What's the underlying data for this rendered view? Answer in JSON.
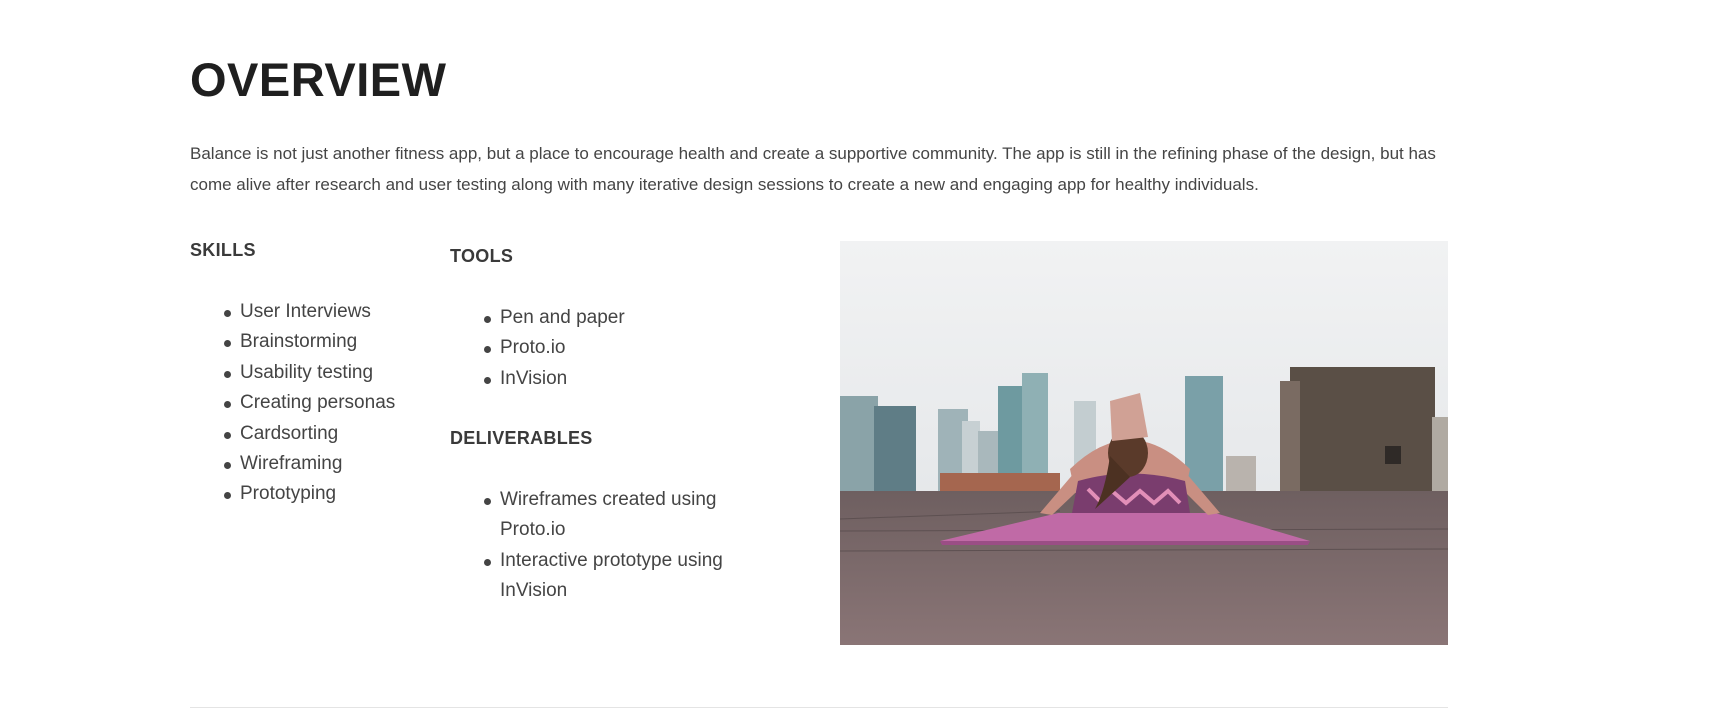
{
  "overview": {
    "title": "OVERVIEW",
    "intro": "Balance is not just another fitness app, but a place to encourage health and create a supportive community. The app is still in the refining phase of the design, but has come alive after research and user testing along with many iterative design sessions to create a new and engaging app for healthy individuals."
  },
  "skills": {
    "heading": "SKILLS",
    "items": [
      "User Interviews",
      "Brainstorming",
      "Usability testing",
      "Creating personas",
      "Cardsorting",
      "Wireframing",
      "Prototyping"
    ]
  },
  "tools": {
    "heading": "TOOLS",
    "items": [
      "Pen and paper",
      "Proto.io",
      "InVision"
    ]
  },
  "deliverables": {
    "heading": "DELIVERABLES",
    "items": [
      "Wireframes created using Proto.io",
      "Interactive prototype using InVision"
    ]
  },
  "colors": {
    "text": "#444444",
    "heading": "#1f1f1f",
    "divider": "#e4e4e4",
    "mat": "#c06aa6"
  }
}
